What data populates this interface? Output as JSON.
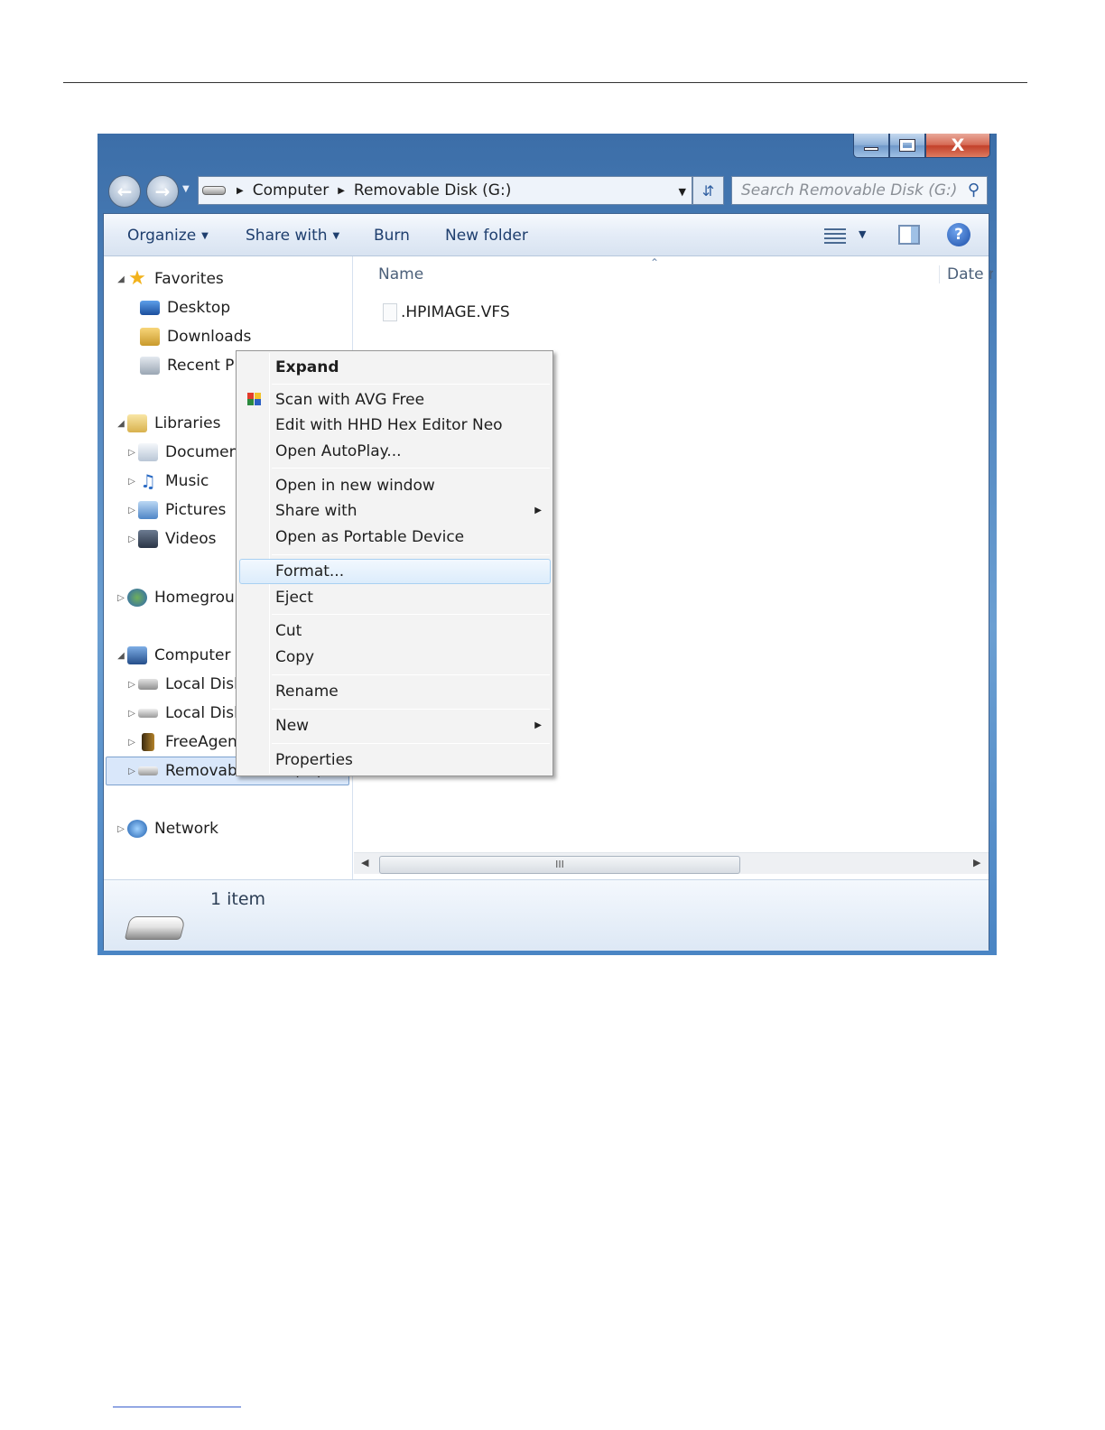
{
  "window": {
    "controls": {
      "minimize": "minimize",
      "maximize": "maximize",
      "close": "X"
    }
  },
  "address": {
    "crumbs": [
      "Computer",
      "Removable Disk (G:)"
    ],
    "search_placeholder": "Search Removable Disk (G:)"
  },
  "toolbar": {
    "organize": "Organize",
    "share_with": "Share with",
    "burn": "Burn",
    "new_folder": "New folder"
  },
  "navpane": {
    "favorites": "Favorites",
    "desktop": "Desktop",
    "downloads": "Downloads",
    "recent_places": "Recent Pl",
    "libraries": "Libraries",
    "documents": "Documen",
    "music": "Music",
    "pictures": "Pictures",
    "videos": "Videos",
    "homegroup": "Homegrou",
    "computer": "Computer",
    "local_disk_1": "Local Disk",
    "local_disk_2": "Local Disk",
    "freeagent": "FreeAgen",
    "removable_disk": "Removable Disk (G:)",
    "network": "Network"
  },
  "filelist": {
    "columns": {
      "name": "Name",
      "date": "Date m"
    },
    "files": [
      ".HPIMAGE.VFS"
    ],
    "scroll_grip": "III"
  },
  "details": {
    "count": "1 item"
  },
  "context_menu": {
    "expand": "Expand",
    "scan_avg": "Scan with AVG Free",
    "edit_hhd": "Edit with HHD Hex Editor Neo",
    "open_autoplay": "Open AutoPlay...",
    "open_new_window": "Open in new window",
    "share_with": "Share with",
    "open_portable": "Open as Portable Device",
    "format": "Format...",
    "eject": "Eject",
    "cut": "Cut",
    "copy": "Copy",
    "rename": "Rename",
    "new": "New",
    "properties": "Properties"
  },
  "colors": {
    "frame": "#4d82bc",
    "hover_border": "#a8d0f2",
    "selection": "#d9e7fa",
    "close_button": "#c2402a"
  }
}
